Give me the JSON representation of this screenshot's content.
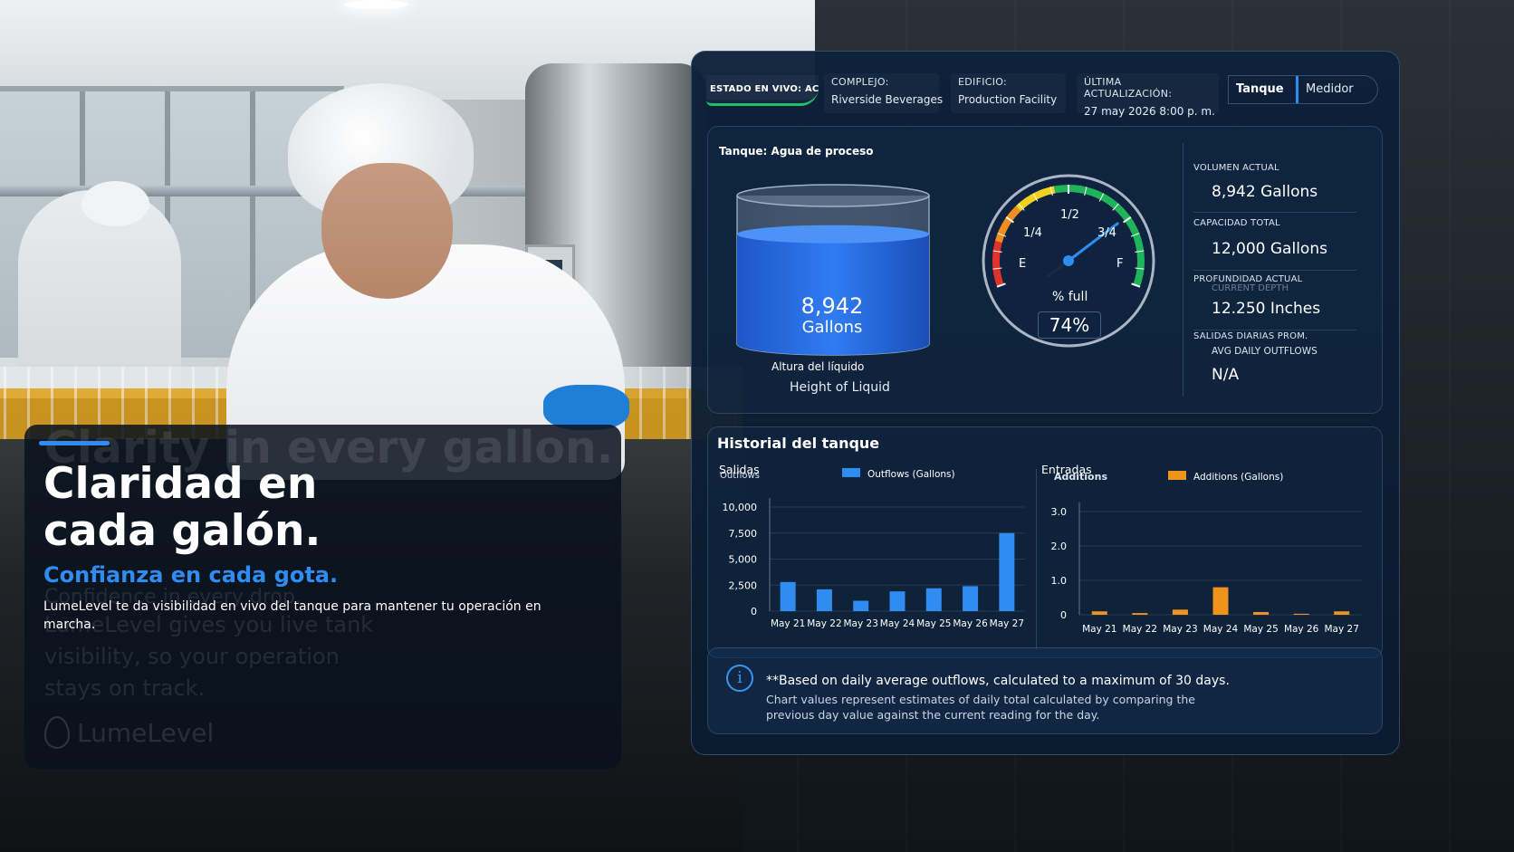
{
  "hero": {
    "ghost_title": "Clarity in every gallon.",
    "ghost_subtitle": "Confidence in every drop.",
    "ghost_body": "LumeLevel gives you live tank visibility, so your operation stays on track.",
    "ghost_brand": "LumeLevel",
    "title_line1": "Claridad en",
    "title_line2": "cada galón.",
    "subtitle": "Confianza en cada gota.",
    "body": "LumeLevel te da visibilidad en vivo del tanque para mantener tu operación en marcha."
  },
  "topbar": {
    "status": "ESTADO EN VIVO: ACTIVO",
    "complex_label": "COMPLEJO:",
    "complex_value": "Riverside Beverages",
    "building_label": "EDIFICIO:",
    "building_value": "Production Facility",
    "updated_label": "ÚLTIMA ACTUALIZACIÓN:",
    "updated_value": "27 may 2026 8:00 p. m.",
    "toggle_tank": "Tanque",
    "toggle_meter": "Medidor"
  },
  "tank": {
    "title": "Tanque: Agua de proceso",
    "volume_number": "8,942",
    "volume_unit": "Gallons",
    "fill_fraction": 0.74,
    "height_label_es": "Altura del líquido",
    "height_label_en": "Height of Liquid"
  },
  "gauge": {
    "label_e": "E",
    "label_quarter": "1/4",
    "label_half": "1/2",
    "label_three_quarter": "3/4",
    "label_f": "F",
    "pct_label": "% full",
    "pct_value": "74%",
    "fill_fraction": 0.74,
    "colors": {
      "red": "#e0332a",
      "orange": "#f28c1e",
      "yellow": "#f2d21e",
      "green": "#1fb35a",
      "needle": "#2f8cf0"
    }
  },
  "stats": {
    "volume_label": "VOLUMEN ACTUAL",
    "volume_value": "8,942 Gallons",
    "capacity_label": "CAPACIDAD TOTAL",
    "capacity_value": "12,000 Gallons",
    "depth_label": "PROFUNDIDAD ACTUAL",
    "depth_ghost": "CURRENT DEPTH",
    "depth_value": "12.250 Inches",
    "outflow_label": "SALIDAS DIARIAS PROM.",
    "outflow_ghost": "AVG DAILY OUTFLOWS",
    "outflow_value": "N/A"
  },
  "history": {
    "title": "Historial del tanque",
    "outflows_es": "Salidas",
    "outflows_ghost": "Outflows",
    "additions_es": "Entradas",
    "additions_ghost": "Additions"
  },
  "chart_data": [
    {
      "type": "bar",
      "title": "Salidas",
      "categories": [
        "May 21",
        "May 22",
        "May 23",
        "May 24",
        "May 25",
        "May 26",
        "May 27"
      ],
      "series": [
        {
          "name": "Outflows (Gallons)",
          "values": [
            2800,
            2100,
            1000,
            1900,
            2200,
            2400,
            7500
          ]
        }
      ],
      "yticks": [
        "10,000",
        "7,500",
        "5,000",
        "2,500",
        "0"
      ],
      "ylim": [
        0,
        10000
      ],
      "color": "#2f8cf0",
      "legend": "top"
    },
    {
      "type": "bar",
      "title": "Entradas",
      "categories": [
        "May 21",
        "May 22",
        "May 23",
        "May 24",
        "May 25",
        "May 26",
        "May 27"
      ],
      "series": [
        {
          "name": "Additions (Gallons)",
          "values": [
            0.1,
            0.05,
            0.15,
            0.8,
            0.08,
            0.03,
            0.1
          ]
        }
      ],
      "yticks": [
        "3.0",
        "2.0",
        "1.0",
        "0"
      ],
      "ylim": [
        0,
        3
      ],
      "color": "#f0921e",
      "legend": "top"
    }
  ],
  "info": {
    "icon": "info-icon",
    "main": "**Based on daily average outflows, calculated to a maximum of 30 days.",
    "sub": "Chart values represent estimates of daily total calculated by comparing the previous day value against the current reading for the day."
  }
}
